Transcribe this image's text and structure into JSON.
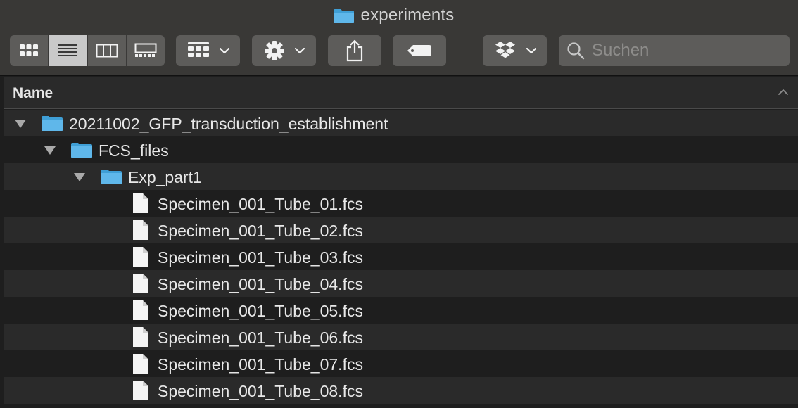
{
  "window": {
    "title": "experiments"
  },
  "toolbar": {
    "view_buttons": [
      "icon-view",
      "list-view",
      "column-view",
      "gallery-view"
    ],
    "active_view": "list-view",
    "search": {
      "placeholder": "Suchen",
      "value": ""
    }
  },
  "list": {
    "column_name": "Name",
    "items": [
      {
        "name": "20211002_GFP_transduction_establishment",
        "kind": "folder",
        "expanded": true,
        "level": 0
      },
      {
        "name": "FCS_files",
        "kind": "folder",
        "expanded": true,
        "level": 1
      },
      {
        "name": "Exp_part1",
        "kind": "folder",
        "expanded": true,
        "level": 2
      },
      {
        "name": "Specimen_001_Tube_01.fcs",
        "kind": "file",
        "level": 3
      },
      {
        "name": "Specimen_001_Tube_02.fcs",
        "kind": "file",
        "level": 3
      },
      {
        "name": "Specimen_001_Tube_03.fcs",
        "kind": "file",
        "level": 3
      },
      {
        "name": "Specimen_001_Tube_04.fcs",
        "kind": "file",
        "level": 3
      },
      {
        "name": "Specimen_001_Tube_05.fcs",
        "kind": "file",
        "level": 3
      },
      {
        "name": "Specimen_001_Tube_06.fcs",
        "kind": "file",
        "level": 3
      },
      {
        "name": "Specimen_001_Tube_07.fcs",
        "kind": "file",
        "level": 3
      },
      {
        "name": "Specimen_001_Tube_08.fcs",
        "kind": "file",
        "level": 3
      }
    ]
  },
  "colors": {
    "folder": "#5fb7ea",
    "folder_dark": "#3f9fd6",
    "file": "#f5f5f5",
    "row_odd": "#2a2a2a",
    "row_even": "#1e1e1e"
  }
}
